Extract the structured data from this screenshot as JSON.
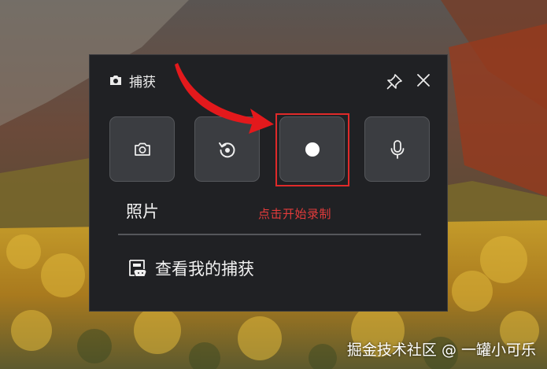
{
  "window": {
    "title": "捕获"
  },
  "icons": {
    "title": "camera-icon",
    "pin": "pin-icon",
    "close": "close-icon",
    "photo": "camera-icon",
    "replay": "replay-icon",
    "record": "record-dot-icon",
    "mic": "microphone-icon",
    "gallery": "gallery-icon"
  },
  "mode": {
    "label": "照片"
  },
  "annotation": {
    "text": "点击开始录制"
  },
  "gallery": {
    "label": "查看我的捕获"
  },
  "watermark": {
    "text": "掘金技术社区 @ 一罐小可乐"
  },
  "colors": {
    "panel_bg": "#202124",
    "button_bg": "#3b3d41",
    "highlight": "#e02a2a",
    "annotation_text": "#e23b3b"
  }
}
